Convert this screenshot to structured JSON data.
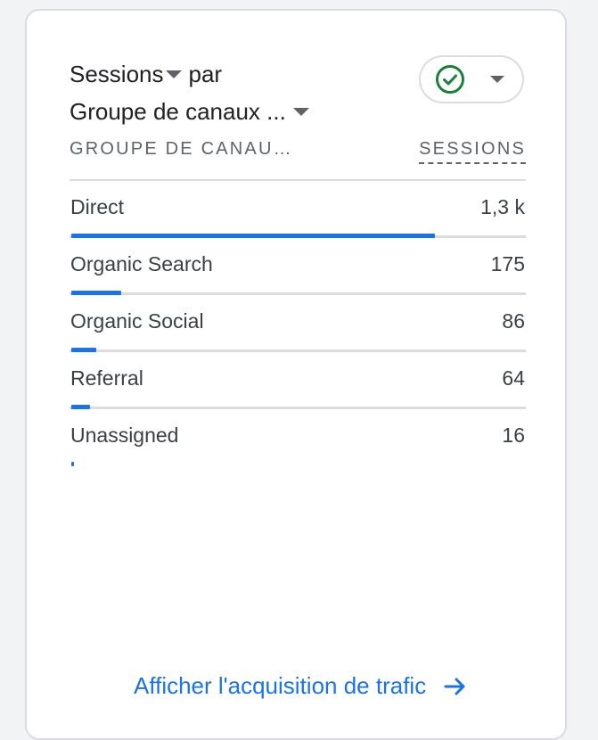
{
  "card": {
    "metric_label": "Sessions",
    "by_label": "par",
    "dimension_label": "Groupe de canaux ...",
    "compare_icon": "check-circle-icon",
    "accent_color": "#1a73e8",
    "check_color": "#188038"
  },
  "table": {
    "dimension_header": "GROUPE DE CANAU…",
    "metric_header": "SESSIONS",
    "rows": [
      {
        "label": "Direct",
        "value": "1,3 k",
        "bar_fraction": 0.8
      },
      {
        "label": "Organic Search",
        "value": "175",
        "bar_fraction": 0.11
      },
      {
        "label": "Organic Social",
        "value": "86",
        "bar_fraction": 0.055
      },
      {
        "label": "Referral",
        "value": "64",
        "bar_fraction": 0.042
      },
      {
        "label": "Unassigned",
        "value": "16",
        "bar_fraction": 0.006
      }
    ]
  },
  "footer": {
    "link_label": "Afficher l'acquisition de trafic"
  }
}
